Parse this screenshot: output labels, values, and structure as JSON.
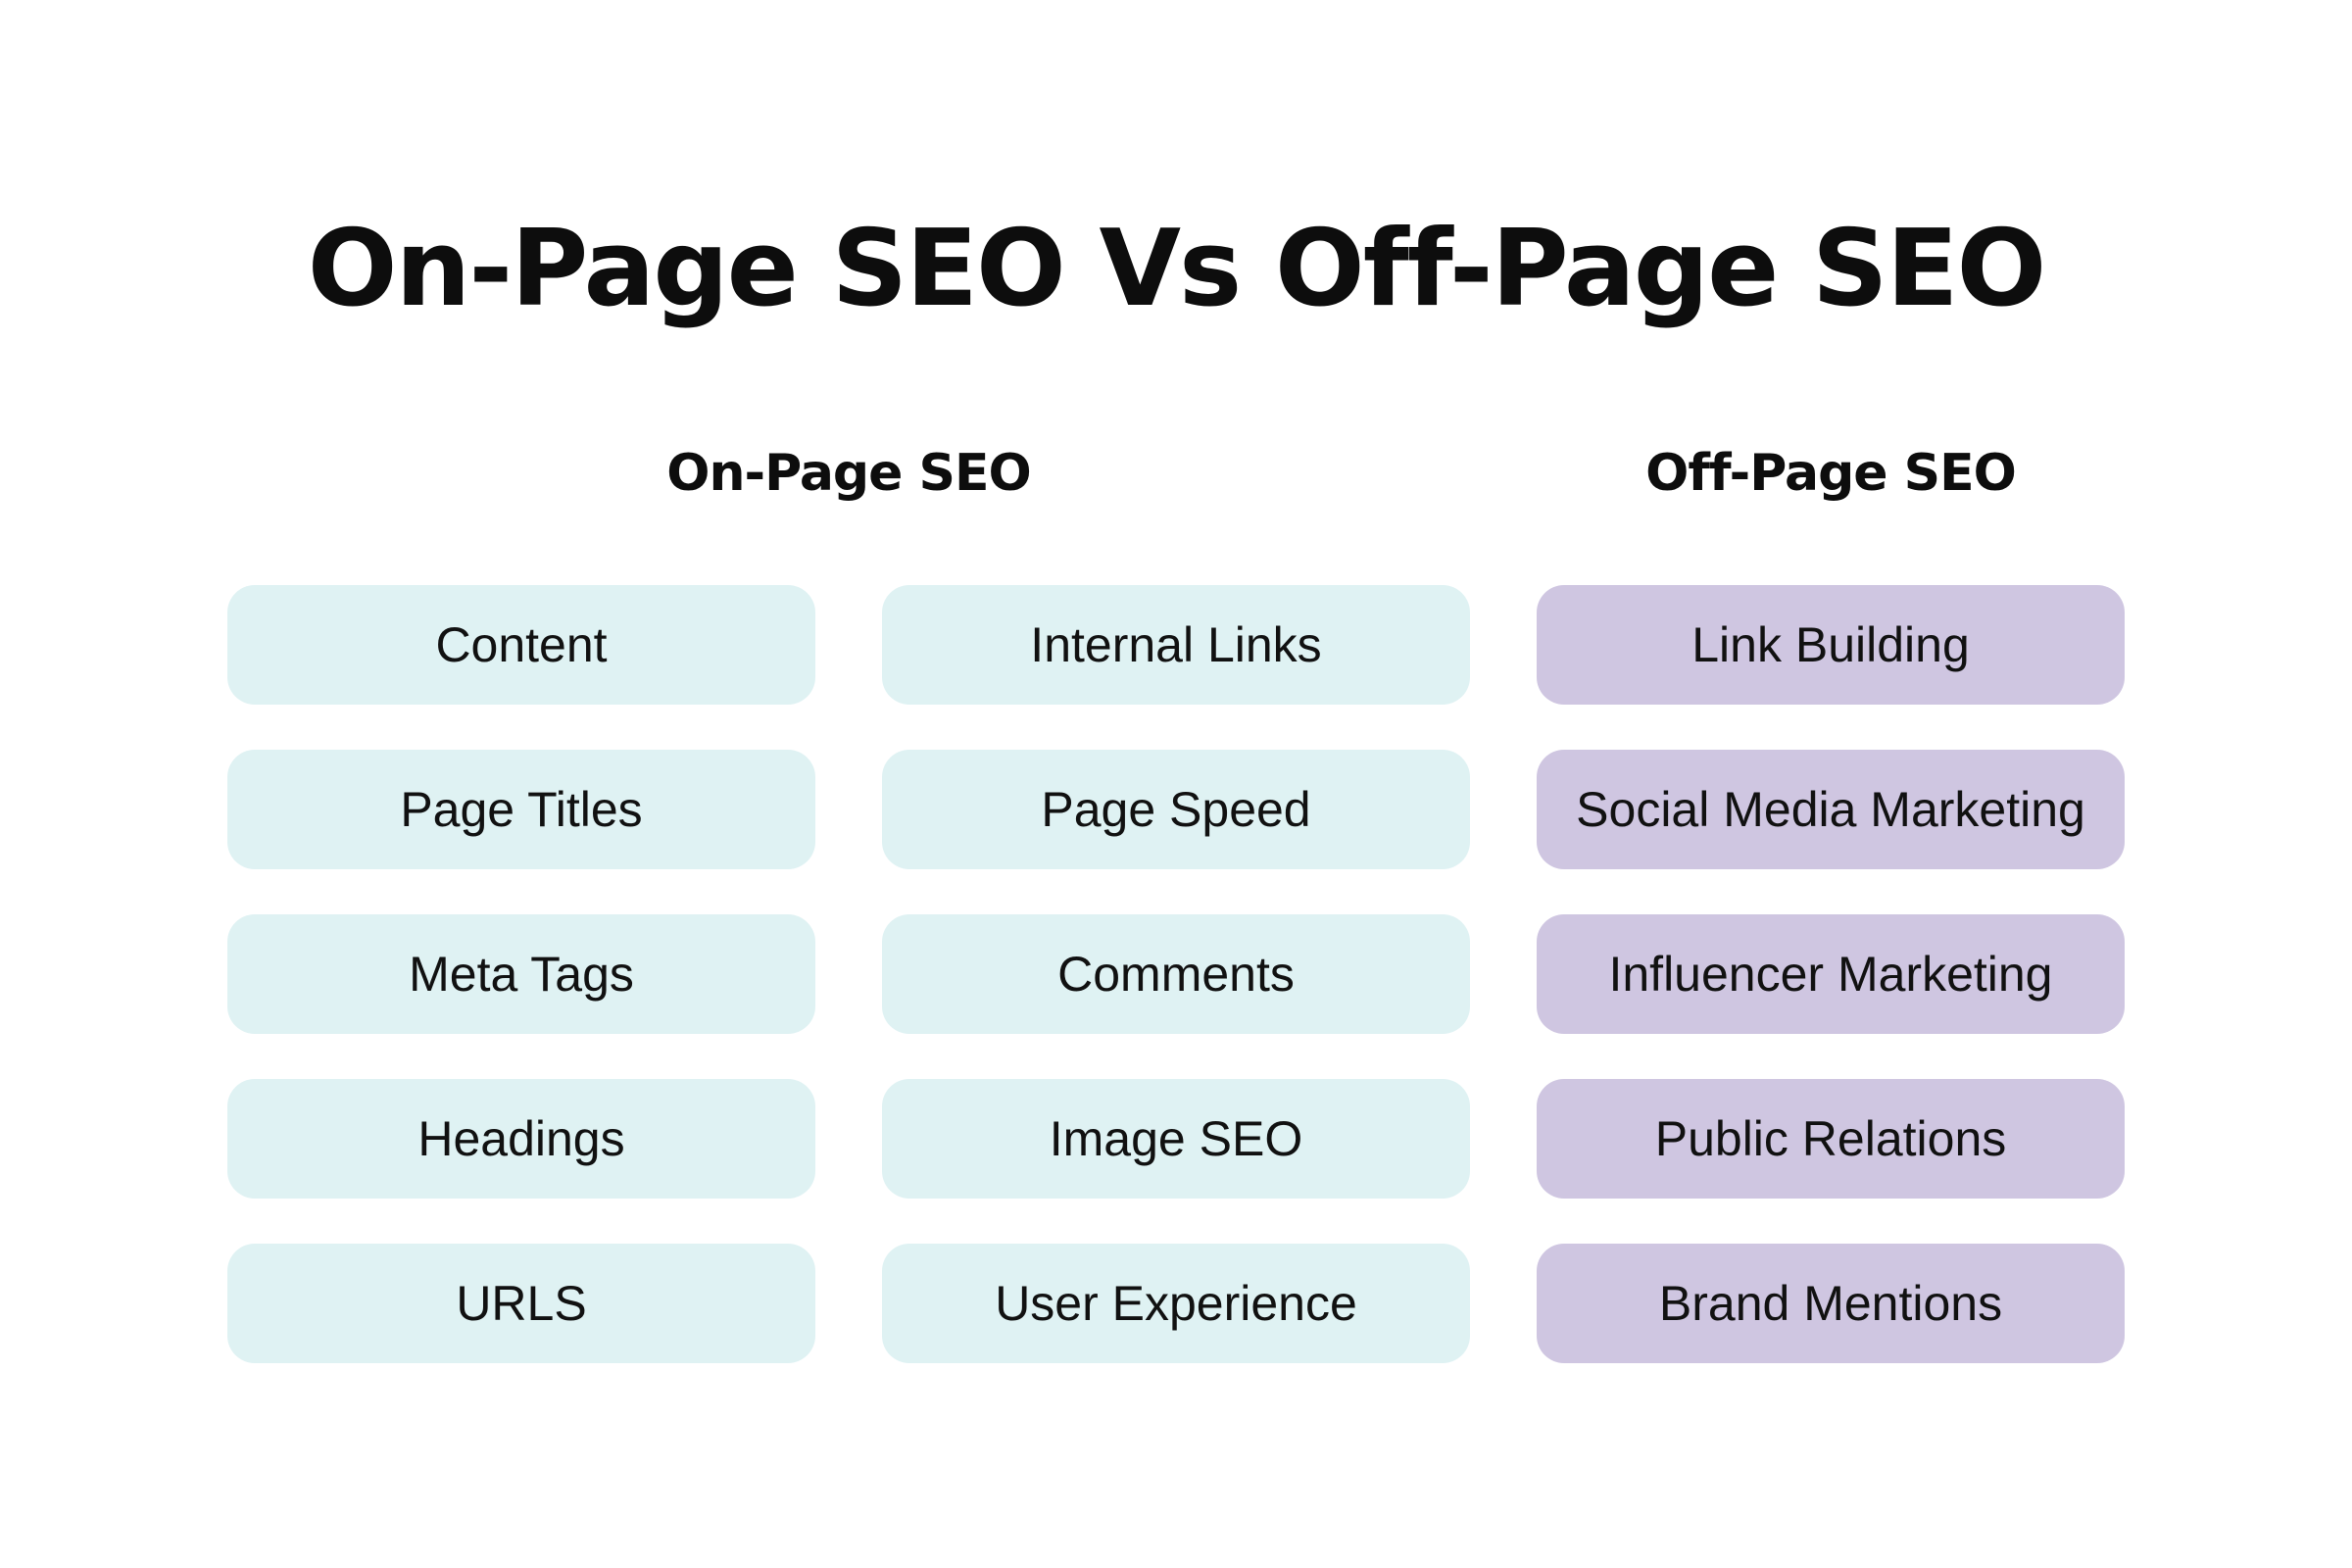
{
  "title": "On-Page SEO Vs Off-Page SEO",
  "colors": {
    "on_page_box": "#dff2f3",
    "off_page_box": "#cfc6e1",
    "text": "#111111",
    "background": "#ffffff"
  },
  "on_page": {
    "heading": "On-Page SEO",
    "column_1": [
      "Content",
      "Page Titles",
      "Meta Tags",
      "Headings",
      "URLS"
    ],
    "column_2": [
      "Internal Links",
      "Page Speed",
      "Comments",
      "Image SEO",
      "User Experience"
    ]
  },
  "off_page": {
    "heading": "Off-Page SEO",
    "items": [
      "Link Building",
      "Social Media Marketing",
      "Influencer Marketing",
      "Public Relations",
      "Brand Mentions"
    ]
  }
}
